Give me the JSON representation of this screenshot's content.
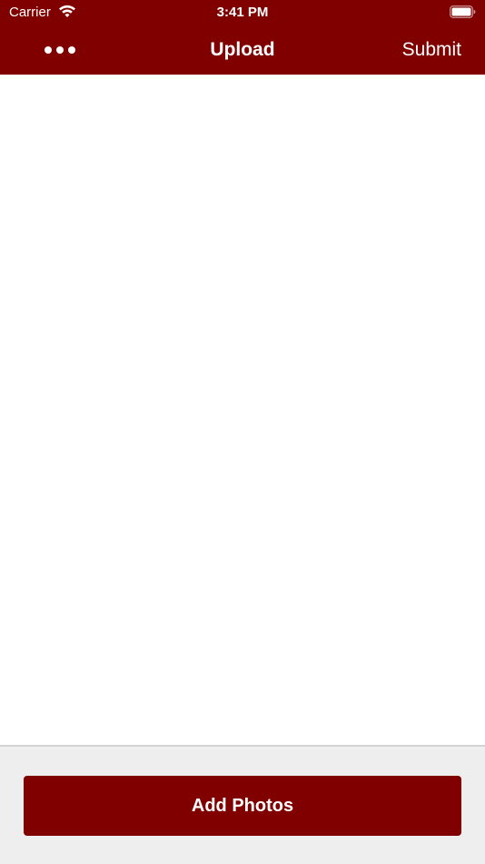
{
  "status_bar": {
    "carrier": "Carrier",
    "time": "3:41 PM",
    "wifi_icon": "wifi-icon",
    "battery_icon": "battery-full-icon"
  },
  "nav": {
    "more_icon": "more-horizontal-icon",
    "title": "Upload",
    "submit_label": "Submit"
  },
  "bottom": {
    "add_photos_label": "Add Photos"
  },
  "colors": {
    "brand": "#800000",
    "panel_background": "#eeeeee",
    "text_on_brand": "#ffffff"
  }
}
